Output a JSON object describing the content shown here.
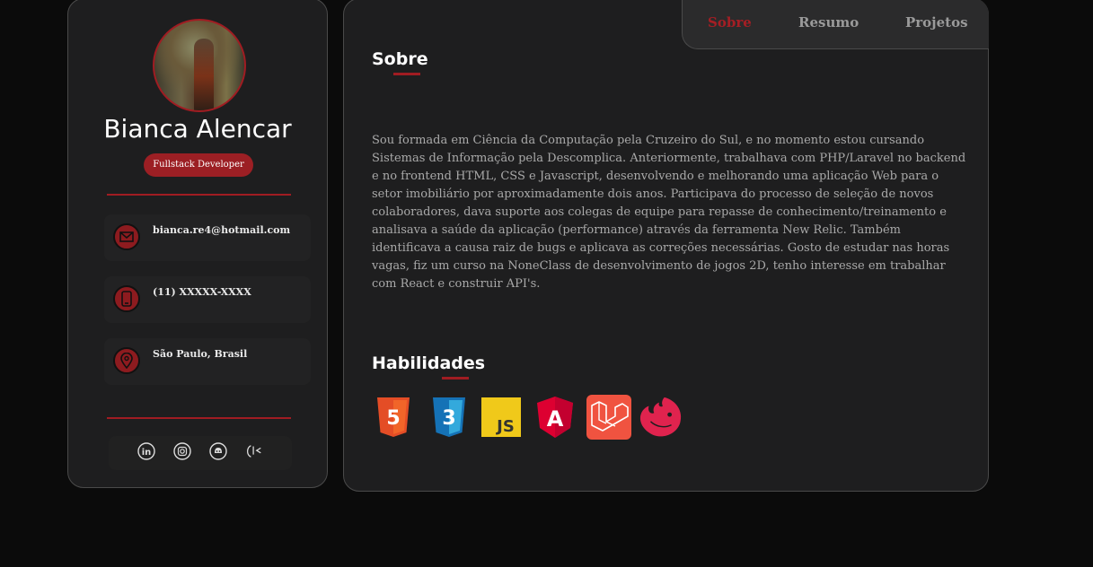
{
  "profile": {
    "name": "Bianca Alencar",
    "role": "Fullstack Developer"
  },
  "contacts": [
    {
      "icon": "mail-icon",
      "text": "bianca.re4@hotmail.com"
    },
    {
      "icon": "phone-icon",
      "text": "(11) XXXXX-XXXX"
    },
    {
      "icon": "location-icon",
      "text": "São Paulo, Brasil"
    }
  ],
  "social": [
    "linkedin-icon",
    "instagram-icon",
    "github-icon",
    "portfolio-icon"
  ],
  "tabs": [
    {
      "label": "Sobre",
      "active": true
    },
    {
      "label": "Resumo",
      "active": false
    },
    {
      "label": "Projetos",
      "active": false
    }
  ],
  "about": {
    "title": "Sobre",
    "text": "Sou formada em Ciência da Computação pela Cruzeiro do Sul, e no momento estou cursando Sistemas de Informação pela Descomplica. Anteriormente, trabalhava com PHP/Laravel no backend e no frontend HTML, CSS e Javascript, desenvolvendo e melhorando uma aplicação Web para o setor imobiliário por aproximadamente dois anos. Participava do processo de seleção de novos colaboradores, dava suporte aos colegas de equipe para repasse de conhecimento/treinamento e analisava a saúde da aplicação (performance) através da ferramenta New Relic. Também identificava a causa raiz de bugs e aplicava as correções necessárias. Gosto de estudar nas horas vagas, fiz um curso na NoneClass de desenvolvimento de jogos 2D, tenho interesse em trabalhar com React e construir API's."
  },
  "skills": {
    "title": "Habilidades",
    "items": [
      {
        "icon": "html5-icon",
        "label": "5"
      },
      {
        "icon": "css3-icon",
        "label": "3"
      },
      {
        "icon": "javascript-icon",
        "label": "JS"
      },
      {
        "icon": "angular-icon",
        "label": "A"
      },
      {
        "icon": "laravel-icon",
        "label": ""
      },
      {
        "icon": "nestjs-icon",
        "label": ""
      }
    ]
  },
  "colors": {
    "accent": "#a01c22",
    "card": "#1e1e1f",
    "background": "#0b0b0b",
    "text_muted": "#a9a9a9"
  }
}
